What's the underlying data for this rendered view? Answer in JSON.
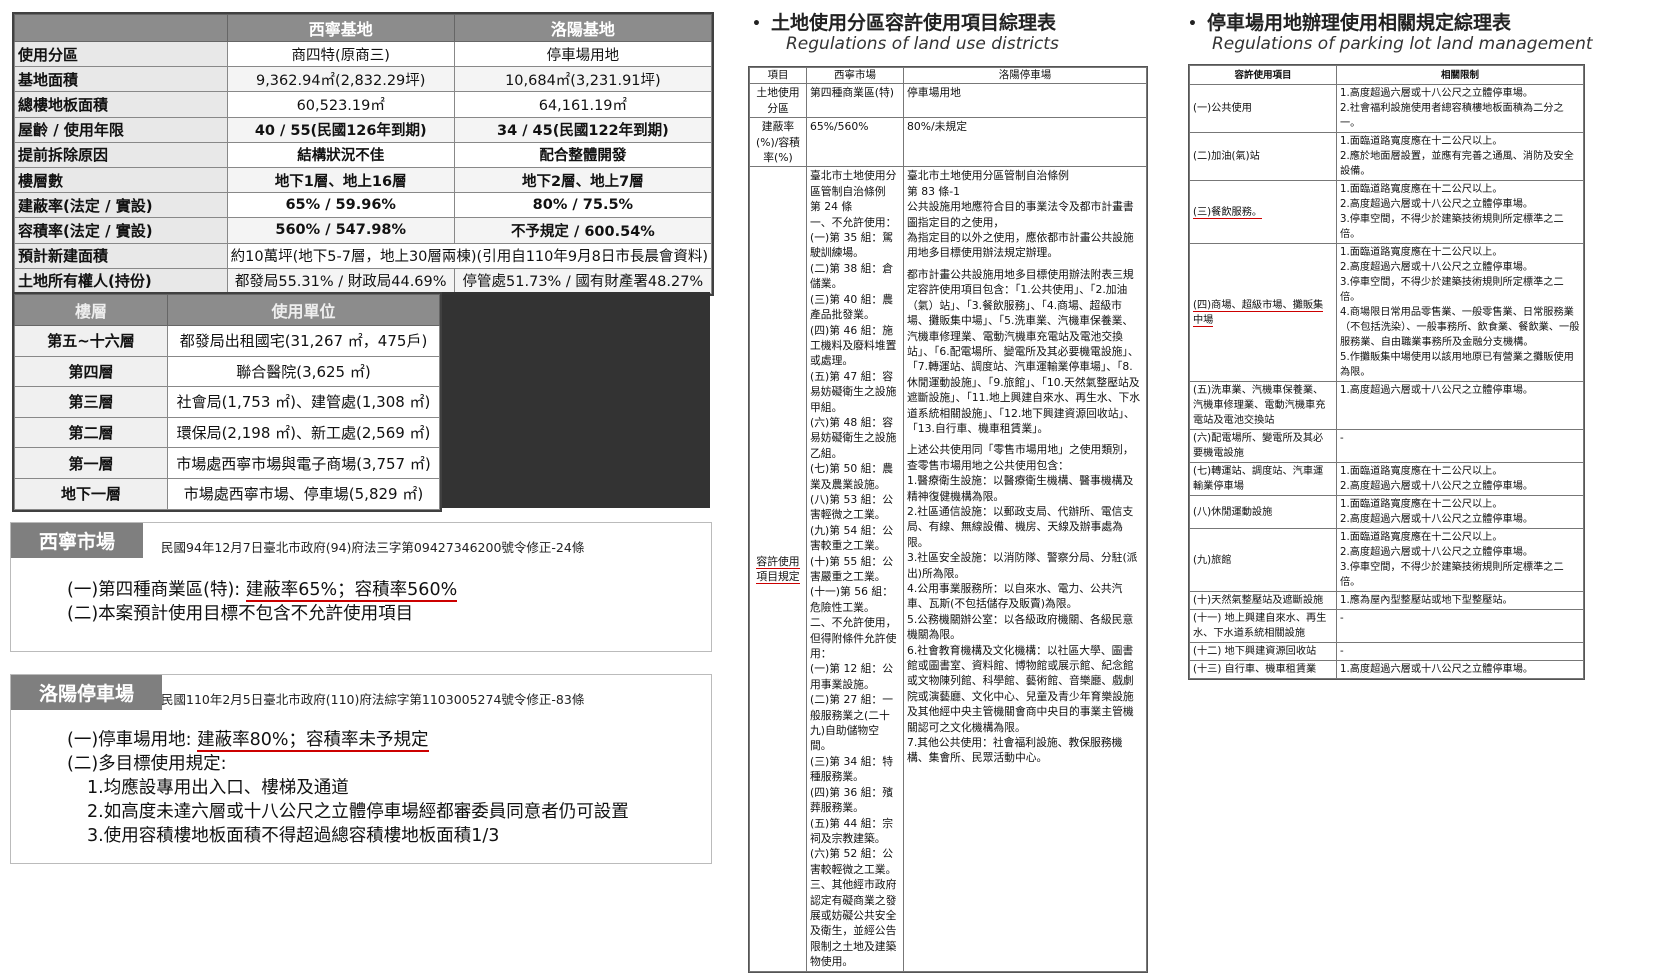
{
  "compare": {
    "headers": [
      "",
      "西寧基地",
      "洛陽基地"
    ],
    "rows": [
      {
        "label": "使用分區",
        "a": "商四特(原商三)",
        "b": "停車場用地"
      },
      {
        "label": "基地面積",
        "a": "9,362.94㎡(2,832.29坪)",
        "b": "10,684㎡(3,231.91坪)"
      },
      {
        "label": "總樓地板面積",
        "a": "60,523.19㎡",
        "b": "64,161.19㎡"
      },
      {
        "label": "屋齡 / 使用年限",
        "a": "40 / 55(民國126年到期)",
        "b": "34 / 45(民國122年到期)"
      },
      {
        "label": "提前拆除原因",
        "a": "結構狀況不佳",
        "b": "配合整體開發"
      },
      {
        "label": "樓層數",
        "a": "地下1層、地上16層",
        "b": "地下2層、地上7層"
      },
      {
        "label": "建蔽率(法定 / 實設)",
        "a": "65% / 59.96%",
        "b": "80% / 75.5%"
      },
      {
        "label": "容積率(法定 / 實設)",
        "a": "560% / 547.98%",
        "b": "不予規定 / 600.54%"
      },
      {
        "label": "預計新建面積",
        "span": "約10萬坪(地下5-7層，地上30層兩棟)(引用自110年9月8日市長晨會資料)"
      },
      {
        "label": "土地所有權人(持份)",
        "a": "都發局55.31% / 財政局44.69%",
        "b": "停管處51.73% / 國有財產署48.27%"
      }
    ]
  },
  "floors": {
    "headers": [
      "樓層",
      "使用單位"
    ],
    "rows": [
      {
        "floor": "第五~十六層",
        "unit": "都發局出租國宅(31,267 ㎡，475戶)"
      },
      {
        "floor": "第四層",
        "unit": "聯合醫院(3,625 ㎡)"
      },
      {
        "floor": "第三層",
        "unit": "社會局(1,753 ㎡)、建管處(1,308 ㎡)"
      },
      {
        "floor": "第二層",
        "unit": "環保局(2,198 ㎡)、新工處(2,569 ㎡)"
      },
      {
        "floor": "第一層",
        "unit": "市場處西寧市場與電子商場(3,757 ㎡)"
      },
      {
        "floor": "地下一層",
        "unit": "市場處西寧市場、停車場(5,829 ㎡)"
      }
    ]
  },
  "card1": {
    "tag": "西寧市場",
    "ref": "民國94年12月7日臺北市政府(94)府法三字第09427346200號令修正-24條",
    "l1a": "(一)第四種商業區(特): ",
    "l1b": "建蔽率65%；容積率560%",
    "l2": "(二)本案預計使用目標不包含不允許使用項目"
  },
  "card2": {
    "tag": "洛陽停車場",
    "ref": "民國110年2月5日臺北市政府(110)府法綜字第1103005274號令修正-83條",
    "l1a": "(一)停車場用地: ",
    "l1b": "建蔽率80%；容積率未予規定",
    "l2": "(二)多目標使用規定:",
    "l3": "1.均應設專用出入口、樓梯及通道",
    "l4": "2.如高度未達六層或十八公尺之立體停車場經都審委員同意者仍可設置",
    "l5": "3.使用容積樓地板面積不得超過總容積樓地板面積1/3"
  },
  "mid": {
    "bullet": "•",
    "title": "土地使用分區容許使用項目綜理表",
    "subtitle": "Regulations of  land use districts",
    "h": [
      "項目",
      "西寧市場",
      "洛陽停車場"
    ],
    "r1": [
      "土地使用分區",
      "第四種商業區(特)",
      "停車場用地"
    ],
    "r2": [
      "建蔽率(%)/容積率(%)",
      "65%/560%",
      "80%/未規定"
    ],
    "r3label": "容許使用項目規定",
    "west": [
      "臺北市土地使用分區管制自治條例",
      "第 24 條",
      "一、不允許使用：",
      "(一)第 35 組：駕駛訓練場。",
      "(二)第 38 組：倉儲業。",
      "(三)第 40 組：農產品批發業。",
      "(四)第 46 組：施工機料及廢料堆置或處理。",
      "(五)第 47 組：容易妨礙衛生之設施甲組。",
      "(六)第 48 組：容易妨礙衛生之設施乙組。",
      "(七)第 50 組：農業及農業設施。",
      "(八)第 53 組：公害輕微之工業。",
      "(九)第 54 組：公害較重之工業。",
      "(十)第 55 組：公害嚴重之工業。",
      "(十一)第 56 組：危險性工業。",
      "二、不允許使用，但得附條件允許使用：",
      "(一)第 12 組：公用事業設施。",
      "(二)第 27 組：一般服務業之(二十九)自助儲物空間。",
      "(三)第 34 組：特種服務業。",
      "(四)第 36 組：殯葬服務業。",
      "(五)第 44 組：宗祠及宗教建築。",
      "(六)第 52 組：公害較輕微之工業。",
      "三、其他經市政府認定有礙商業之發展或妨礙公共安全及衛生，並經公告限制之土地及建築物使用。"
    ],
    "east": [
      "臺北市土地使用分區管制自治條例",
      "第 83 條-1",
      "公共設施用地應符合目的事業法令及都市計畫書圖指定目的之使用，",
      "為指定目的以外之使用，應依都市計畫公共設施用地多目標使用辦法規定辦理。",
      "都市計畫公共設施用地多目標使用辦法附表三規定容許使用項目包含：「1.公共使用」、「2.加油（氣）站」、「3.餐飲服務」、「4.商場、超級市場、攤販集中場」、「5.洗車業、汽機車保養業、汽機車修理業、電動汽機車充電站及電池交換站」、「6.配電場所、變電所及其必要機電設施」、「7.轉運站、調度站、汽車運輸業停車場」、「8.休閒運動設施」、「9.旅館」、「10.天然氣整壓站及遮斷設施」、「11.地上興建自來水、再生水、下水道系統相關設施」、「12.地下興建資源回收站」、「13.自行車、機車租賃業」。",
      "上述公共使用同「零售市場用地」之使用類別，查零售市場用地之公共使用包含：",
      "1.醫療衛生設施：以醫療衛生機構、醫事機構及精神復健機構為限。",
      "2.社區通信設施：以郵政支局、代辦所、電信支局、有線、無線設備、機房、天線及辦事處為限。",
      "3.社區安全設施：以消防隊、警察分局、分駐(派出)所為限。",
      "4.公用事業服務所：以自來水、電力、公共汽車、瓦斯(不包括儲存及販賣)為限。",
      "5.公務機關辦公室：以各級政府機關、各級民意機關為限。",
      "6.社會教育機構及文化機構：以社區大學、圖書館或圖書室、資料館、博物館或展示館、紀念館或文物陳列館、科學館、藝術館、音樂廳、戲劇院或演藝廳、文化中心、兒童及青少年育樂設施及其他經中央主管機關會商中央目的事業主管機關認可之文化機構為限。",
      "7.其他公共使用：社會福利設施、教保服務機構、集會所、民眾活動中心。"
    ]
  },
  "right": {
    "bullet": "•",
    "title": "停車場用地辦理使用相關規定綜理表",
    "subtitle": "Regulations of parking lot land management",
    "h": [
      "容許使用項目",
      "相關限制"
    ],
    "rows": [
      {
        "k": "(一)公共使用",
        "v": [
          "1.高度超過六層或十八公尺之立體停車場。",
          "2.社會福利設施使用者總容積樓地板面積為二分之一。"
        ]
      },
      {
        "k": "(二)加油(氣)站",
        "v": [
          "1.面臨道路寬度應在十二公尺以上。",
          "2.應於地面層設置，並應有完善之通風、消防及安全設備。"
        ]
      },
      {
        "k": "(三)餐飲服務。",
        "v": [
          "1.面臨道路寬度應在十二公尺以上。",
          "2.高度超過六層或十八公尺之立體停車場。",
          "3.停車空間，不得少於建築技術規則所定標準之二倍。"
        ]
      },
      {
        "k": "(四)商場、超級市場、攤販集中場",
        "v": [
          "1.面臨道路寬度應在十二公尺以上。",
          "2.高度超過六層或十八公尺之立體停車場。",
          "3.停車空間，不得少於建築技術規則所定標準之二倍。",
          "4.商場限日常用品零售業、一般零售業、日常服務業（不包括洗染）、一般事務所、飲食業、餐飲業、一般服務業、自由職業事務所及金融分支機構。",
          "5.作攤販集中場使用以該用地原已有營業之攤販使用為限。"
        ]
      },
      {
        "k": "(五)洗車業、汽機車保養業、汽機車修理業、電動汽機車充電站及電池交換站",
        "v": [
          "1.高度超過六層或十八公尺之立體停車場。"
        ]
      },
      {
        "k": "(六)配電場所、變電所及其必要機電設施",
        "v": [
          "-"
        ]
      },
      {
        "k": "(七)轉運站、調度站、汽車運輸業停車場",
        "v": [
          "1.面臨道路寬度應在十二公尺以上。",
          "2.高度超過六層或十八公尺之立體停車場。"
        ]
      },
      {
        "k": "(八)休閒運動設施",
        "v": [
          "1.面臨道路寬度應在十二公尺以上。",
          "2.高度超過六層或十八公尺之立體停車場。"
        ]
      },
      {
        "k": "(九)旅館",
        "v": [
          "1.面臨道路寬度應在十二公尺以上。",
          "2.高度超過六層或十八公尺之立體停車場。",
          "3.停車空間，不得少於建築技術規則所定標準之二倍。"
        ]
      },
      {
        "k": "(十)天然氣整壓站及遮斷設施",
        "v": [
          "1.應為屋內型整壓站或地下型整壓站。"
        ]
      },
      {
        "k": "(十一) 地上興建自來水、再生水、下水道系統相關設施",
        "v": [
          "-"
        ]
      },
      {
        "k": "(十二) 地下興建資源回收站",
        "v": [
          "-"
        ]
      },
      {
        "k": "(十三) 自行車、機車租賃業",
        "v": [
          "1.高度超過六層或十八公尺之立體停車場。"
        ]
      }
    ]
  }
}
